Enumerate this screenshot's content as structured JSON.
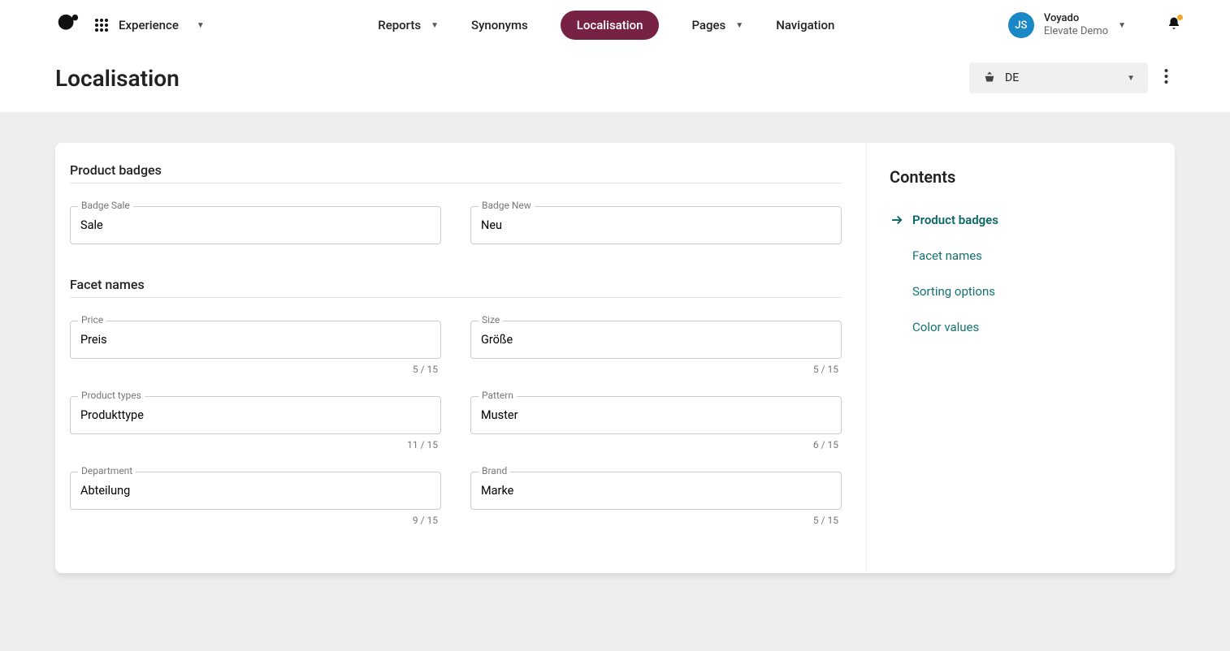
{
  "topbar": {
    "experience_label": "Experience",
    "nav": [
      {
        "label": "Reports",
        "has_dropdown": true
      },
      {
        "label": "Synonyms",
        "has_dropdown": false
      },
      {
        "label": "Localisation",
        "has_dropdown": false,
        "active": true
      },
      {
        "label": "Pages",
        "has_dropdown": true
      },
      {
        "label": "Navigation",
        "has_dropdown": false
      }
    ],
    "avatar_initials": "JS",
    "account_title": "Voyado",
    "account_sub": "Elevate Demo"
  },
  "page": {
    "title": "Localisation",
    "locale": "DE"
  },
  "sections": {
    "product_badges": {
      "title": "Product badges",
      "fields": [
        {
          "label": "Badge Sale",
          "value": "Sale"
        },
        {
          "label": "Badge New",
          "value": "Neu"
        }
      ]
    },
    "facet_names": {
      "title": "Facet names",
      "fields": [
        {
          "label": "Price",
          "value": "Preis",
          "counter": "5 / 15"
        },
        {
          "label": "Size",
          "value": "Größe",
          "counter": "5 / 15"
        },
        {
          "label": "Product types",
          "value": "Produkttype",
          "counter": "11 / 15"
        },
        {
          "label": "Pattern",
          "value": "Muster",
          "counter": "6 / 15"
        },
        {
          "label": "Department",
          "value": "Abteilung",
          "counter": "9 / 15"
        },
        {
          "label": "Brand",
          "value": "Marke",
          "counter": "5 / 15"
        }
      ]
    }
  },
  "contents": {
    "title": "Contents",
    "items": [
      {
        "label": "Product badges",
        "active": true
      },
      {
        "label": "Facet names",
        "active": false
      },
      {
        "label": "Sorting options",
        "active": false
      },
      {
        "label": "Color values",
        "active": false
      }
    ]
  }
}
